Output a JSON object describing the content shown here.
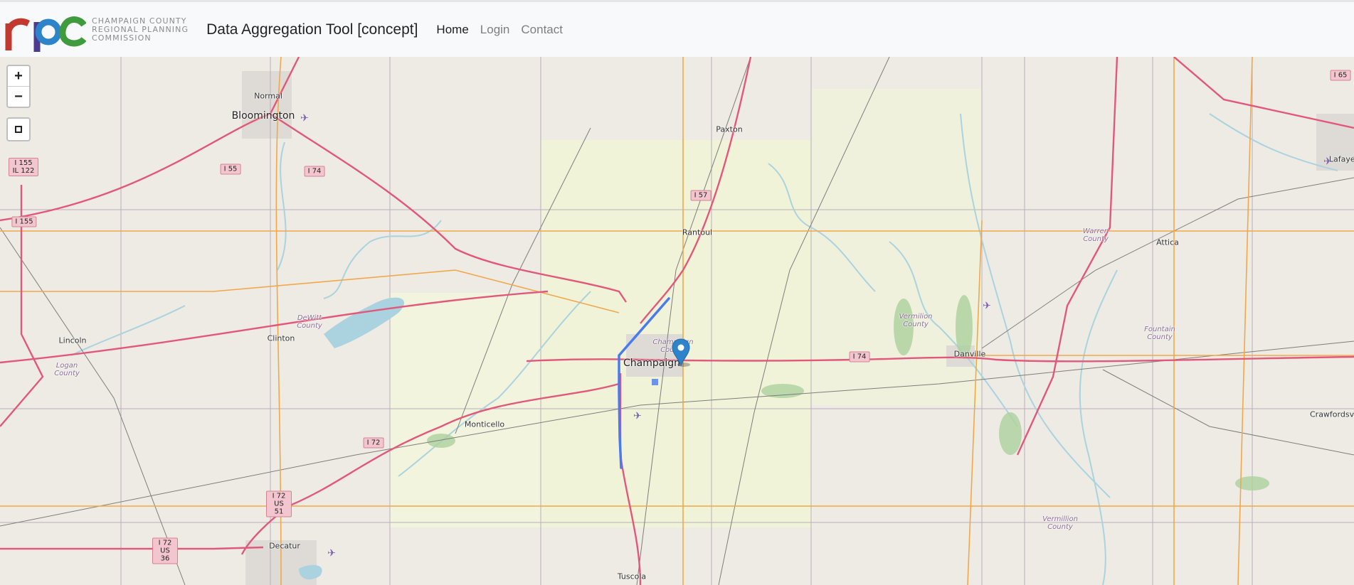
{
  "header": {
    "logo_text": [
      "CHAMPAIGN COUNTY",
      "REGIONAL PLANNING",
      "COMMISSION"
    ],
    "logo_mark": "rpc",
    "title": "Data Aggregation Tool [concept]",
    "nav": [
      {
        "label": "Home",
        "active": true
      },
      {
        "label": "Login",
        "active": false
      },
      {
        "label": "Contact",
        "active": false
      }
    ]
  },
  "map": {
    "controls": {
      "zoom_in": "+",
      "zoom_out": "−",
      "draw_icon": "square-icon"
    },
    "cities": [
      "Normal",
      "Bloomington",
      "Paxton",
      "Rantoul",
      "Lincoln",
      "Clinton",
      "Champaign",
      "Monticello",
      "Decatur",
      "Tuscola",
      "Danville",
      "Attica",
      "Crawfordsville",
      "Lafayette"
    ],
    "big_cities": [
      "Bloomington",
      "Champaign",
      "Decatur"
    ],
    "counties": [
      "DeWitt County",
      "Logan County",
      "Champaign County",
      "Vermilion County",
      "Warren County",
      "Fountain County",
      "Vermillion County"
    ],
    "shields": [
      "I 155 IL 122",
      "I 155",
      "I 55",
      "I 74",
      "I 57",
      "I 74",
      "I 72",
      "I 72 US 51",
      "I 72 US 36",
      "I 65"
    ],
    "colors": {
      "land": "#eeebe4",
      "county_highlight": "#f1f3d8",
      "interstate": "#e2587a",
      "highway": "#f0a84b",
      "water": "#aad3df",
      "selection": "#4a7af0",
      "marker": "#2e83cb"
    }
  }
}
